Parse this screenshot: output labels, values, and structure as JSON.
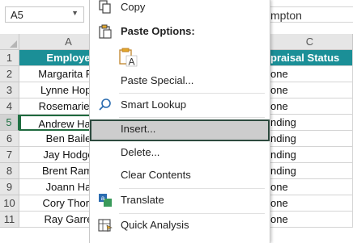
{
  "name_box": {
    "value": "A5"
  },
  "formula_bar": {
    "text": "mpton"
  },
  "columns": {
    "a": "A",
    "c": "C"
  },
  "rows": [
    "1",
    "2",
    "3",
    "4",
    "5",
    "6",
    "7",
    "8",
    "9",
    "10",
    "11"
  ],
  "table": {
    "header_a": "Employe",
    "header_c": "praisal Status",
    "col_a": [
      "Margarita Pe",
      "Lynne Hopk",
      "Rosemarie L",
      "Andrew Ham",
      "Ben Baile",
      "Jay Hodge",
      "Brent Rami",
      "Joann Ha",
      "Cory Thom",
      "Ray Garre"
    ],
    "col_c": [
      "one",
      "one",
      "one",
      "nding",
      "nding",
      "nding",
      "nding",
      "one",
      "one",
      "one"
    ]
  },
  "context_menu": {
    "copy": "Copy",
    "paste_options": "Paste Options:",
    "paste_special": "Paste Special...",
    "smart_lookup": "Smart Lookup",
    "insert": "Insert...",
    "delete": "Delete...",
    "clear_contents": "Clear Contents",
    "translate": "Translate",
    "quick_analysis": "Quick Analysis"
  },
  "colors": {
    "header_fill": "#1b8f97",
    "selection": "#217346"
  }
}
